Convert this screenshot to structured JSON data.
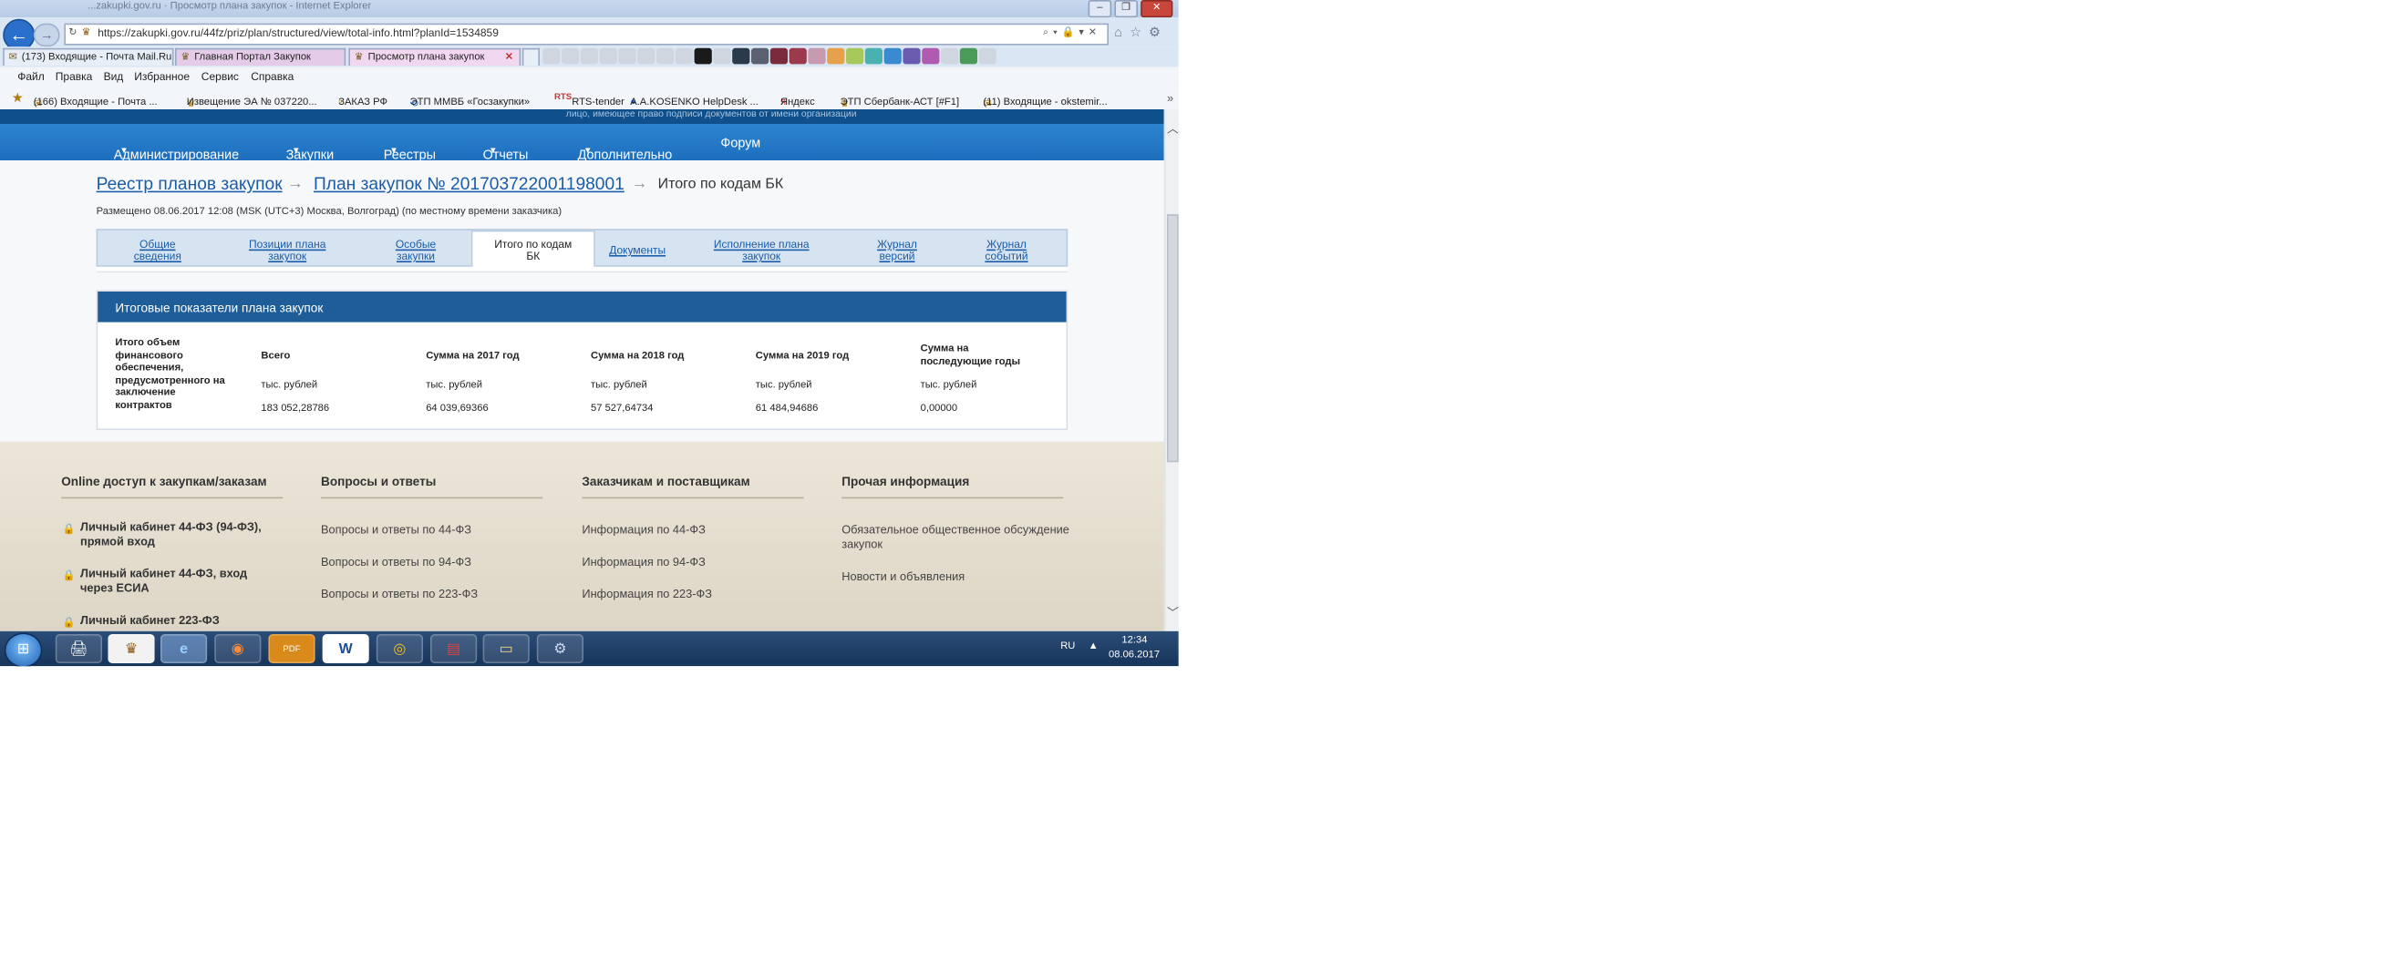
{
  "browser": {
    "window_title": "...zakupki.gov.ru · Просмотр плана закупок - Internet Explorer",
    "url": "https://zakupki.gov.ru/44fz/priz/plan/structured/view/total-info.html?planId=1534859",
    "tabs": [
      {
        "label": "(173) Входящие - Почта Mail.Ru"
      },
      {
        "label": "Главная Портал Закупок"
      },
      {
        "label": "Просмотр плана закупок",
        "active": true
      }
    ],
    "menu": [
      "Файл",
      "Правка",
      "Вид",
      "Избранное",
      "Сервис",
      "Справка"
    ],
    "favorites": [
      "(166) Входящие - Почта ...",
      "Извещение ЭА № 037220...",
      "ЗАКАЗ РФ",
      "ЭТП ММВБ «Госзакупки»",
      "RTS-tender",
      "A.A.KOSENKO HelpDesk ...",
      "Яндекс",
      "ЭТП Сбербанк-АСТ [#F1]",
      "(11) Входящие - okstemir..."
    ],
    "rts_logo": "RTS",
    "colors": {
      "accent": "#1f5d99",
      "nav": "#1d6fbe"
    }
  },
  "page": {
    "top_band_text": "лицо, имеющее право подписи документов от имени организации",
    "nav": [
      "Администрирование",
      "Закупки",
      "Реестры",
      "Отчеты",
      "Дополнительно",
      "Форум"
    ],
    "breadcrumb": {
      "root": "Реестр планов закупок",
      "plan": "План закупок № 201703722001198001",
      "current": "Итого по кодам БК"
    },
    "placed": "Размещено 08.06.2017 12:08 (MSK (UTC+3) Москва, Волгоград) (по местному времени заказчика)",
    "tabs": [
      {
        "l1": "Общие",
        "l2": "сведения"
      },
      {
        "l1": "Позиции плана",
        "l2": "закупок"
      },
      {
        "l1": "Особые",
        "l2": "закупки"
      },
      {
        "l1": "Итого по кодам",
        "l2": "БК",
        "active": true
      },
      {
        "l1": "Документы",
        "l2": ""
      },
      {
        "l1": "Исполнение плана",
        "l2": "закупок"
      },
      {
        "l1": "Журнал",
        "l2": "версий"
      },
      {
        "l1": "Журнал",
        "l2": "событий"
      }
    ],
    "panel": {
      "title": "Итоговые показатели плана закупок",
      "row_label": "Итого объем финансового обеспечения, предусмотренного на заключение контрактов",
      "columns": [
        {
          "header": "Всего",
          "unit": "тыс. рублей",
          "value": "183 052,28786"
        },
        {
          "header": "Сумма на 2017 год",
          "unit": "тыс. рублей",
          "value": "64 039,69366"
        },
        {
          "header": "Сумма на 2018 год",
          "unit": "тыс. рублей",
          "value": "57 527,64734"
        },
        {
          "header": "Сумма на 2019 год",
          "unit": "тыс. рублей",
          "value": "61 484,94686"
        },
        {
          "header": "Сумма на последующие годы",
          "unit": "тыс. рублей",
          "value": "0,00000"
        }
      ]
    },
    "footer": {
      "cols": [
        {
          "title": "Online доступ к закупкам/заказам",
          "links": [
            "Личный кабинет 44-ФЗ (94-ФЗ), прямой вход",
            "Личный кабинет 44-ФЗ, вход через ЕСИА",
            "Личный кабинет 223-ФЗ"
          ]
        },
        {
          "title": "Вопросы и ответы",
          "links": [
            "Вопросы и ответы по 44-ФЗ",
            "Вопросы и ответы по 94-ФЗ",
            "Вопросы и ответы по 223-ФЗ"
          ]
        },
        {
          "title": "Заказчикам и поставщикам",
          "links": [
            "Информация по 44-ФЗ",
            "Информация по 94-ФЗ",
            "Информация по 223-ФЗ"
          ]
        },
        {
          "title": "Прочая информация",
          "links": [
            "Обязательное общественное обсуждение закупок",
            "Новости и объявления"
          ]
        }
      ]
    }
  },
  "taskbar": {
    "lang": "RU",
    "time": "12:34",
    "date": "08.06.2017",
    "apps": [
      "explorer",
      "gerb",
      "internet-explorer",
      "firefox",
      "pdf",
      "word",
      "chrome",
      "flag",
      "folder",
      "tool"
    ],
    "labels": {
      "pdf": "PDF",
      "word": "W"
    }
  }
}
